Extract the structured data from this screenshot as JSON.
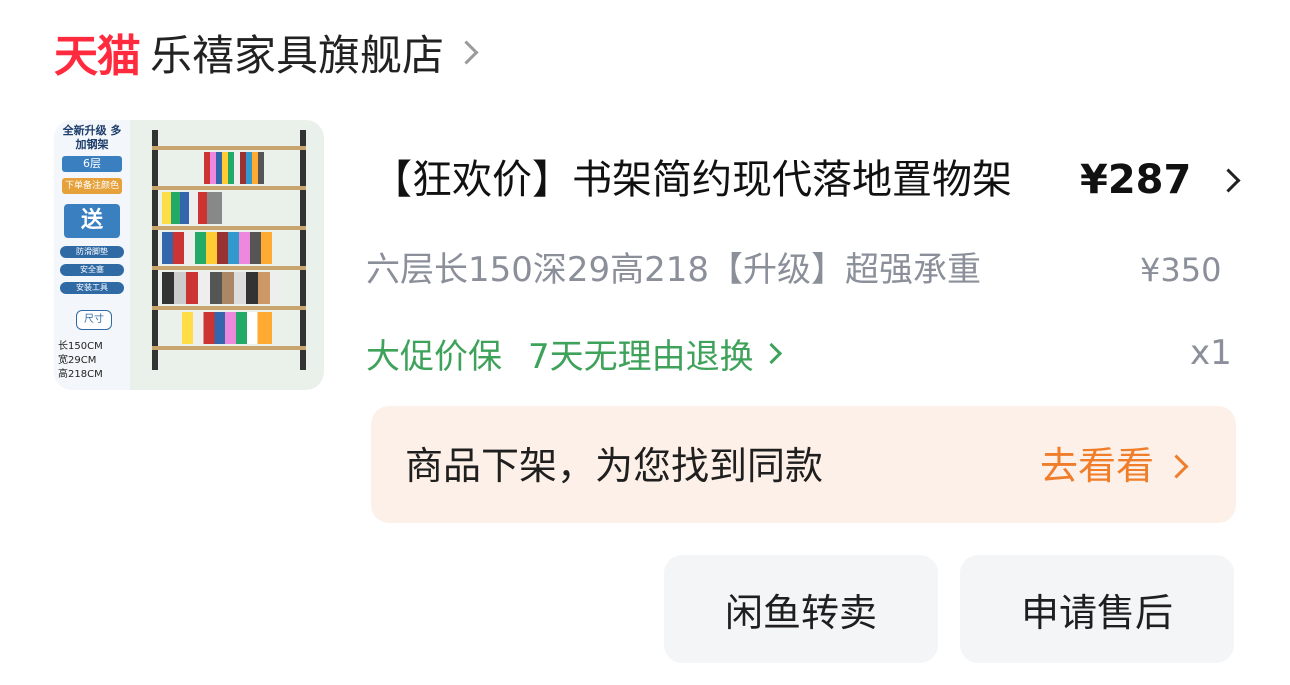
{
  "store": {
    "platform_logo": "天猫",
    "name": "乐禧家具旗舰店",
    "chevron_icon": "chevron-right-icon"
  },
  "product": {
    "image_text": {
      "headline": "全新升级 多加钢架",
      "layers": "6层",
      "color_note": "下单备注颜色",
      "gift": "送",
      "features": [
        "防滑脚垫",
        "安全塞",
        "安装工具"
      ],
      "size_label": "尺寸",
      "sizes": [
        "长150CM",
        "宽29CM",
        "高218CM"
      ]
    },
    "title": "【狂欢价】书架简约现代落地置物架",
    "price": "¥287",
    "sku": "六层长150深29高218【升级】超强承重",
    "original_price": "¥350",
    "service_1": "大促价保",
    "service_2": "7天无理由退换",
    "quantity": "x1"
  },
  "banner": {
    "text": "商品下架，为您找到同款",
    "link": "去看看"
  },
  "buttons": {
    "resell": "闲鱼转卖",
    "after_sale": "申请售后"
  },
  "colors": {
    "tmall_red": "#ff2a3d",
    "green": "#3fa25b",
    "orange": "#ef7d2a",
    "banner_bg": "#fdf0e8"
  }
}
